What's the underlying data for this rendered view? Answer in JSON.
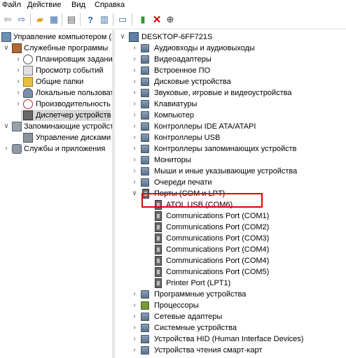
{
  "menu": [
    "Файл",
    "Действие",
    "Вид",
    "Справка"
  ],
  "left_tree": [
    {
      "label": "Управление компьютером (л",
      "icon": "computer-management-icon"
    },
    {
      "label": "Служебные программы",
      "icon": "tools-icon"
    },
    {
      "label": "Планировщик заданий",
      "icon": "clock-icon"
    },
    {
      "label": "Просмотр событий",
      "icon": "event-viewer-icon"
    },
    {
      "label": "Общие папки",
      "icon": "shared-folder-icon"
    },
    {
      "label": "Локальные пользовате",
      "icon": "users-icon"
    },
    {
      "label": "Производительность",
      "icon": "performance-icon"
    },
    {
      "label": "Диспетчер устройств",
      "icon": "device-manager-icon"
    },
    {
      "label": "Запоминающие устройств",
      "icon": "storage-icon"
    },
    {
      "label": "Управление дисками",
      "icon": "disk-icon"
    },
    {
      "label": "Службы и приложения",
      "icon": "services-icon"
    }
  ],
  "right_tree": {
    "root": "DESKTOP-6FF721S",
    "categories": [
      "Аудиовходы и аудиовыходы",
      "Видеоадаптеры",
      "Встроенное ПО",
      "Дисковые устройства",
      "Звуковые, игровые и видеоустройства",
      "Клавиатуры",
      "Компьютер",
      "Контроллеры IDE ATA/ATAPI",
      "Контроллеры USB",
      "Контроллеры запоминающих устройств",
      "Мониторы",
      "Мыши и иные указывающие устройства",
      "Очереди печати",
      "Порты (COM и LPT)"
    ],
    "ports": [
      "ATOL USB (COM6)",
      "Communications Port (COM1)",
      "Communications Port (COM2)",
      "Communications Port (COM3)",
      "Communications Port (COM4)",
      "Communications Port (COM4)",
      "Communications Port (COM5)",
      "Printer Port (LPT1)"
    ],
    "categories_after": [
      "Программные устройства",
      "Процессоры",
      "Сетевые адаптеры",
      "Системные устройства",
      "Устройства HID (Human Interface Devices)",
      "Устройства чтения смарт-карт"
    ]
  }
}
